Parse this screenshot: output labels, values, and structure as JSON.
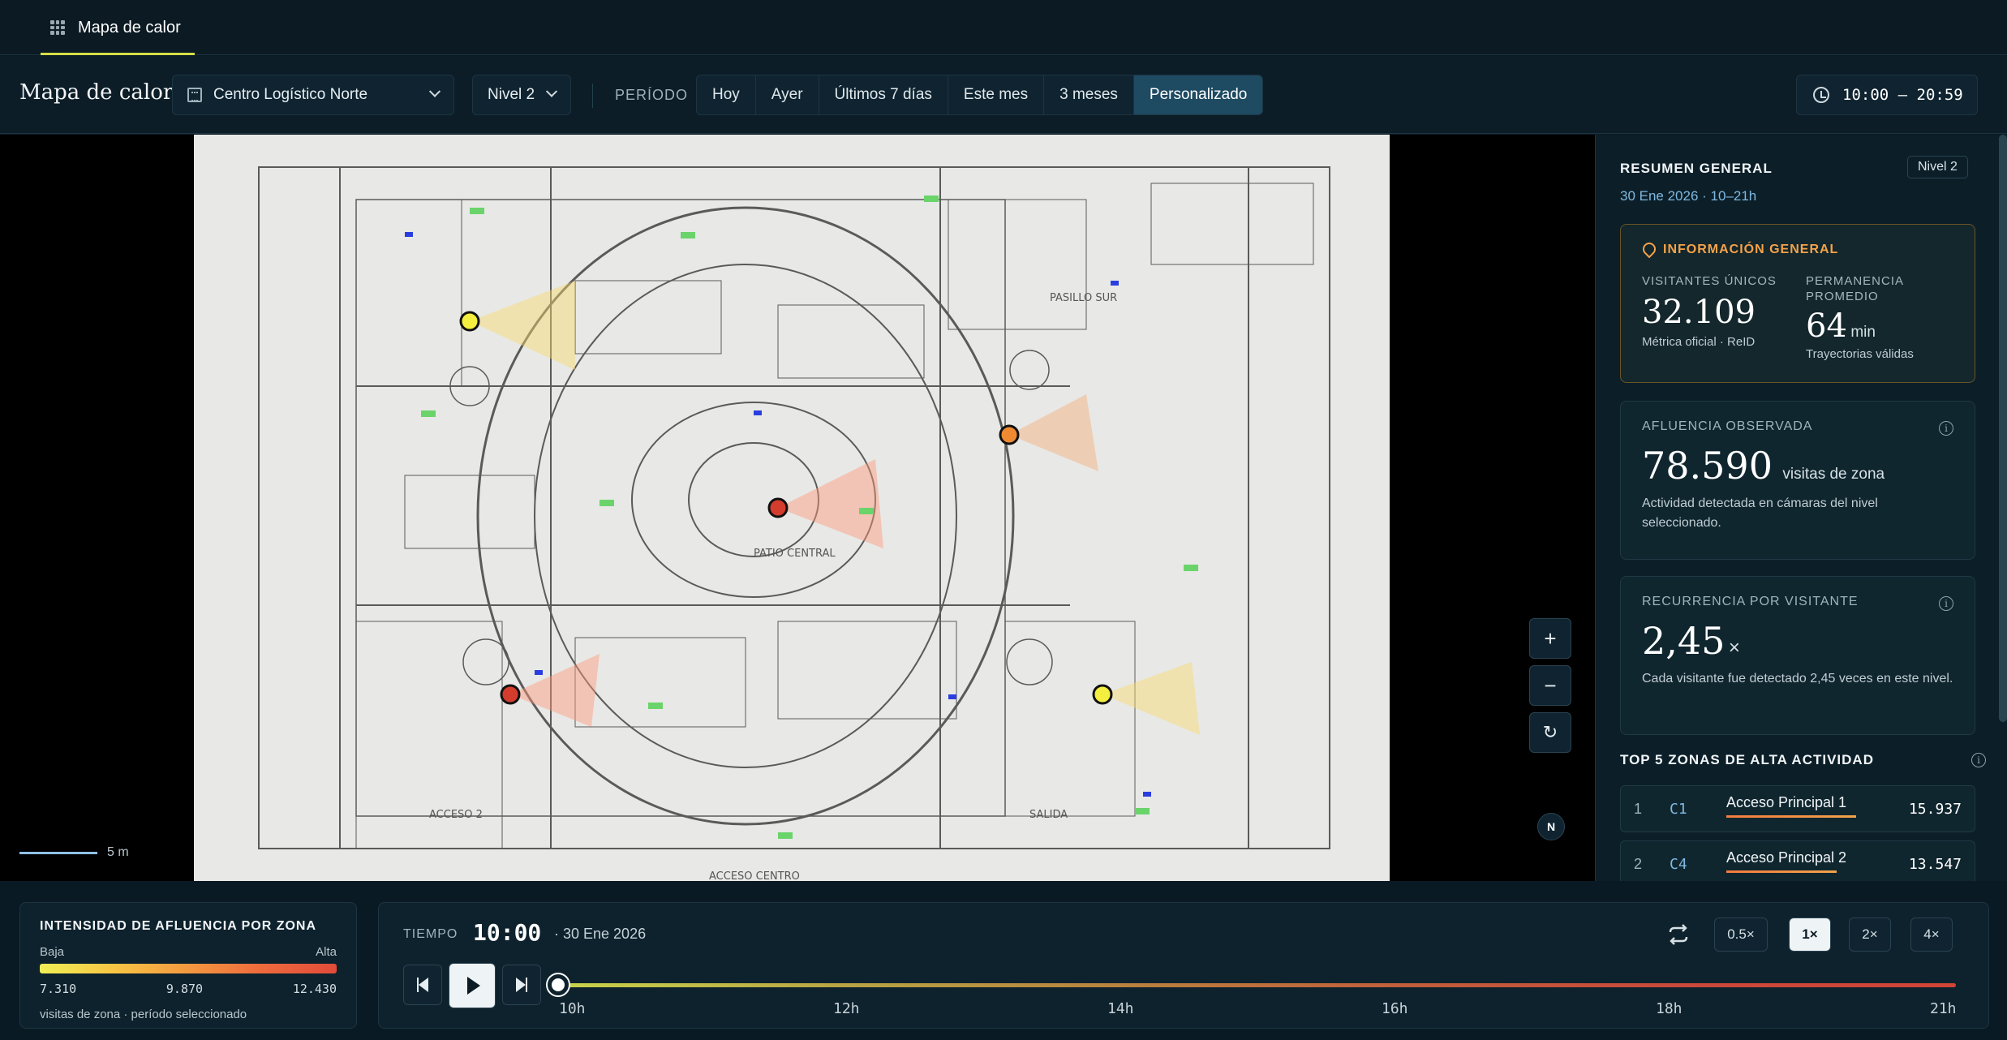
{
  "topbar": {
    "tab_label": "Mapa de calor",
    "tab_icon": "grid-icon"
  },
  "toolbar": {
    "title": "Mapa de calor",
    "site": "Centro Logístico Norte",
    "level": "Nivel 2",
    "period_label": "PERÍODO",
    "periods": [
      "Hoy",
      "Ayer",
      "Últimos 7 días",
      "Este mes",
      "3 meses",
      "Personalizado"
    ],
    "active_period": "Personalizado",
    "time_range": "10:00 – 20:59"
  },
  "map": {
    "labels": [
      "PASILLO SUR",
      "PATIO CENTRAL",
      "ACCESO 2",
      "ACCESO CENTRO",
      "SALIDA"
    ],
    "scale_label": "5 m",
    "north_label": "N",
    "zoom_in": "+",
    "zoom_out": "−",
    "reset": "↻"
  },
  "sidebar": {
    "title": "RESUMEN GENERAL",
    "subtitle": "30 Ene 2026 · 10–21h",
    "badge": "Nivel 2",
    "general": {
      "title": "INFORMACIÓN GENERAL",
      "visitors_label": "VISITANTES ÚNICOS",
      "visitors_value": "32.109",
      "visitors_note": "Métrica oficial · ReID",
      "stay_label": "PERMANENCIA PROMEDIO",
      "stay_value": "64",
      "stay_unit": "min",
      "stay_note": "Trayectorias válidas"
    },
    "flow": {
      "title": "AFLUENCIA OBSERVADA",
      "value": "78.590",
      "unit": "visitas de zona",
      "note": "Actividad detectada en cámaras del nivel seleccionado."
    },
    "recurrence": {
      "title": "RECURRENCIA POR VISITANTE",
      "value": "2,45",
      "unit": "×",
      "note": "Cada visitante fue detectado 2,45 veces en este nivel."
    },
    "top5_title": "TOP 5 ZONAS DE ALTA ACTIVIDAD",
    "top5": [
      {
        "rank": "1",
        "code": "C1",
        "name": "Acceso Principal 1",
        "value": "15.937",
        "share": 1.0
      },
      {
        "rank": "2",
        "code": "C4",
        "name": "Acceso Principal 2",
        "value": "13.547",
        "share": 0.85
      }
    ]
  },
  "legend": {
    "title": "INTENSIDAD DE AFLUENCIA POR ZONA",
    "low": "Baja",
    "high": "Alta",
    "ticks": [
      "7.310",
      "9.870",
      "12.430"
    ],
    "note": "visitas de zona · período seleccionado"
  },
  "player": {
    "label": "TIEMPO",
    "time": "10:00",
    "date": "· 30 Ene 2026",
    "hours": [
      "10h",
      "12h",
      "14h",
      "16h",
      "18h",
      "21h"
    ],
    "speeds": [
      "0.5×",
      "1×",
      "2×",
      "4×"
    ],
    "active_speed": "1×"
  },
  "colors": {
    "accent": "#f5a24a",
    "active_segment": "#1e4a62",
    "heat_low": "#f0ef55",
    "heat_high": "#e14b3a"
  }
}
